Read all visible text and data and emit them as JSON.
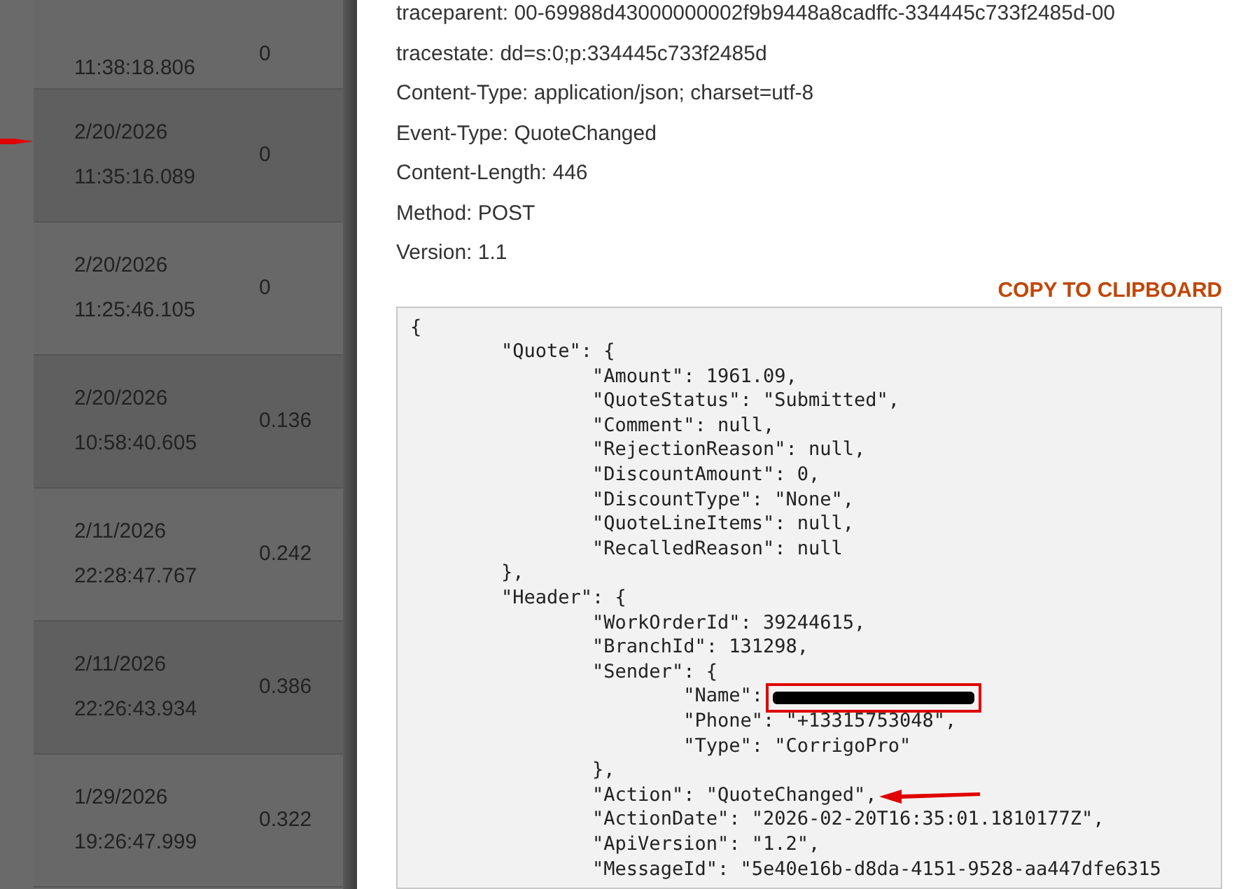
{
  "log_list": {
    "rows": [
      {
        "date": "",
        "time": "11:38:18.806",
        "value": "0"
      },
      {
        "date": "2/20/2026",
        "time": "11:35:16.089",
        "value": "0"
      },
      {
        "date": "2/20/2026",
        "time": "11:25:46.105",
        "value": "0"
      },
      {
        "date": "2/20/2026",
        "time": "10:58:40.605",
        "value": "0.136"
      },
      {
        "date": "2/11/2026",
        "time": "22:28:47.767",
        "value": "0.242"
      },
      {
        "date": "2/11/2026",
        "time": "22:26:43.934",
        "value": "0.386"
      },
      {
        "date": "1/29/2026",
        "time": "19:26:47.999",
        "value": "0.322"
      }
    ]
  },
  "details": {
    "headers": [
      "traceparent: 00-69988d43000000002f9b9448a8cadffc-334445c733f2485d-00",
      "tracestate: dd=s:0;p:334445c733f2485d",
      "Content-Type: application/json; charset=utf-8",
      "Event-Type: QuoteChanged",
      "Content-Length: 446",
      "Method: POST",
      "Version: 1.1"
    ],
    "copy_button": "COPY TO CLIPBOARD",
    "body_lines": [
      {
        "text": "{",
        "kind": "plain"
      },
      {
        "text": "\t\"Quote\": {",
        "kind": "plain"
      },
      {
        "text": "\t\t\"Amount\": 1961.09,",
        "kind": "plain"
      },
      {
        "text": "\t\t\"QuoteStatus\": \"Submitted\",",
        "kind": "plain"
      },
      {
        "text": "\t\t\"Comment\": null,",
        "kind": "plain"
      },
      {
        "text": "\t\t\"RejectionReason\": null,",
        "kind": "plain"
      },
      {
        "text": "\t\t\"DiscountAmount\": 0,",
        "kind": "plain"
      },
      {
        "text": "\t\t\"DiscountType\": \"None\",",
        "kind": "plain"
      },
      {
        "text": "\t\t\"QuoteLineItems\": null,",
        "kind": "plain"
      },
      {
        "text": "\t\t\"RecalledReason\": null",
        "kind": "plain"
      },
      {
        "text": "\t},",
        "kind": "plain"
      },
      {
        "text": "\t\"Header\": {",
        "kind": "plain"
      },
      {
        "text": "\t\t\"WorkOrderId\": 39244615,",
        "kind": "plain"
      },
      {
        "text": "\t\t\"BranchId\": 131298,",
        "kind": "plain"
      },
      {
        "text": "\t\t\"Sender\": {",
        "kind": "plain"
      },
      {
        "text": "\t\t\t\"Name\":",
        "kind": "redacted"
      },
      {
        "text": "\t\t\t\"Phone\": \"+13315753048\",",
        "kind": "plain"
      },
      {
        "text": "\t\t\t\"Type\": \"CorrigoPro\"",
        "kind": "plain"
      },
      {
        "text": "\t\t},",
        "kind": "plain"
      },
      {
        "text": "\t\t\"Action\": \"QuoteChanged\",",
        "kind": "arrow"
      },
      {
        "text": "\t\t\"ActionDate\": \"2026-02-20T16:35:01.1810177Z\",",
        "kind": "plain"
      },
      {
        "text": "\t\t\"ApiVersion\": \"1.2\",",
        "kind": "plain"
      },
      {
        "text": "\t\t\"MessageId\": \"5e40e16b-d8da-4151-9528-aa447dfe6315",
        "kind": "plain"
      }
    ]
  }
}
